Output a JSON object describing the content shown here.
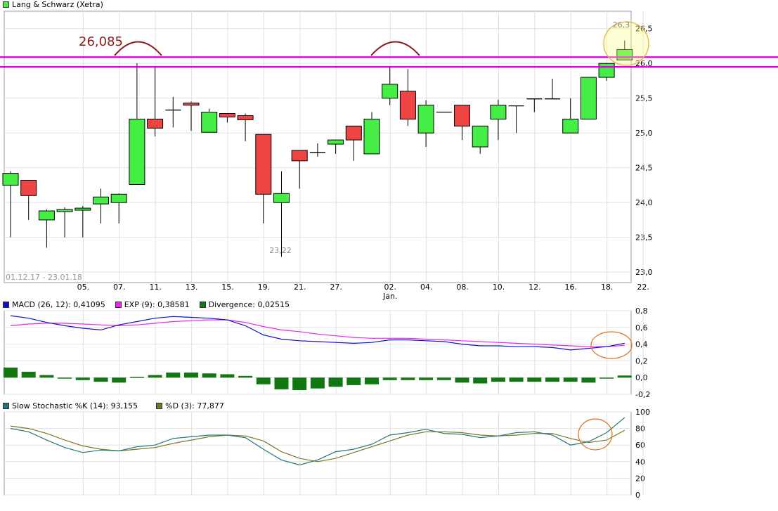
{
  "chart_data": [
    {
      "type": "candlestick",
      "title": "Lang & Schwarz (Xetra)",
      "date_range": "01.12.17 - 23.01.18",
      "x_ticks": [
        "05.",
        "07.",
        "11.",
        "13.",
        "15.",
        "19.",
        "21.",
        "27.",
        "02.",
        "04.",
        "08.",
        "10.",
        "12.",
        "16.",
        "18.",
        "22."
      ],
      "x_sublabel": "Jan.",
      "y_ticks": [
        "26,5",
        "26,0",
        "25,5",
        "25,0",
        "24,5",
        "24,0",
        "23,5",
        "23,0"
      ],
      "ylim": [
        22.85,
        26.75
      ],
      "candles": [
        {
          "o": 24.25,
          "h": 24.45,
          "l": 23.5,
          "c": 24.42
        },
        {
          "o": 24.32,
          "h": 24.32,
          "l": 23.75,
          "c": 24.1
        },
        {
          "o": 23.75,
          "h": 23.9,
          "l": 23.35,
          "c": 23.88
        },
        {
          "o": 23.87,
          "h": 23.93,
          "l": 23.5,
          "c": 23.9
        },
        {
          "o": 23.89,
          "h": 23.95,
          "l": 23.5,
          "c": 23.92
        },
        {
          "o": 23.98,
          "h": 24.2,
          "l": 23.7,
          "c": 24.08
        },
        {
          "o": 24.0,
          "h": 24.13,
          "l": 23.7,
          "c": 24.12
        },
        {
          "o": 24.26,
          "h": 26.0,
          "l": 24.26,
          "c": 25.2
        },
        {
          "o": 25.2,
          "h": 25.95,
          "l": 24.95,
          "c": 25.07
        },
        {
          "o": 25.33,
          "h": 25.52,
          "l": 25.08,
          "c": 25.33
        },
        {
          "o": 25.43,
          "h": 25.45,
          "l": 25.03,
          "c": 25.4
        },
        {
          "o": 25.01,
          "h": 25.35,
          "l": 25.01,
          "c": 25.3
        },
        {
          "o": 25.28,
          "h": 25.28,
          "l": 25.15,
          "c": 25.23
        },
        {
          "o": 25.25,
          "h": 25.28,
          "l": 24.88,
          "c": 25.19
        },
        {
          "o": 24.98,
          "h": 24.98,
          "l": 23.7,
          "c": 24.12
        },
        {
          "o": 24.0,
          "h": 24.45,
          "l": 23.22,
          "c": 24.13
        },
        {
          "o": 24.75,
          "h": 24.75,
          "l": 24.2,
          "c": 24.6
        },
        {
          "o": 24.72,
          "h": 24.85,
          "l": 24.66,
          "c": 24.72
        },
        {
          "o": 24.84,
          "h": 24.9,
          "l": 24.7,
          "c": 24.9
        },
        {
          "o": 25.1,
          "h": 25.1,
          "l": 24.6,
          "c": 24.9
        },
        {
          "o": 24.7,
          "h": 25.3,
          "l": 24.7,
          "c": 25.2
        },
        {
          "o": 25.5,
          "h": 25.95,
          "l": 25.4,
          "c": 25.7
        },
        {
          "o": 25.6,
          "h": 25.92,
          "l": 25.1,
          "c": 25.2
        },
        {
          "o": 25.0,
          "h": 25.47,
          "l": 24.8,
          "c": 25.4
        },
        {
          "o": 25.3,
          "h": 25.3,
          "l": 25.3,
          "c": 25.3
        },
        {
          "o": 25.4,
          "h": 25.4,
          "l": 24.9,
          "c": 25.1
        },
        {
          "o": 24.8,
          "h": 25.1,
          "l": 24.7,
          "c": 25.1
        },
        {
          "o": 25.2,
          "h": 25.48,
          "l": 24.9,
          "c": 25.4
        },
        {
          "o": 25.39,
          "h": 25.39,
          "l": 25.0,
          "c": 25.39
        },
        {
          "o": 25.49,
          "h": 25.49,
          "l": 25.3,
          "c": 25.49
        },
        {
          "o": 25.49,
          "h": 25.78,
          "l": 25.49,
          "c": 25.49
        },
        {
          "o": 25.0,
          "h": 25.5,
          "l": 25.0,
          "c": 25.2
        },
        {
          "o": 25.2,
          "h": 25.8,
          "l": 25.2,
          "c": 25.8
        },
        {
          "o": 25.8,
          "h": 26.0,
          "l": 25.75,
          "c": 26.0
        },
        {
          "o": 26.05,
          "h": 26.33,
          "l": 26.05,
          "c": 26.2
        }
      ],
      "up_color": "#44ee44",
      "down_color": "#ee4444",
      "annotations": {
        "resistance_label": "26,085",
        "low_label": "23,22",
        "high_label": "26,3",
        "resistance_values": [
          26.09,
          25.95
        ],
        "resistance_color": "#dd00dd"
      }
    },
    {
      "type": "line",
      "indicator": "MACD",
      "legend": [
        {
          "label": "MACD (26, 12): 0,41095",
          "color": "#1010cc"
        },
        {
          "label": "EXP (9): 0,38581",
          "color": "#ee22ee"
        },
        {
          "label": "Divergence: 0,02515",
          "color": "#117711"
        }
      ],
      "y_ticks": [
        "0,8",
        "0,6",
        "0,4",
        "0,2",
        "0,0",
        "-0,2"
      ],
      "ylim": [
        -0.2,
        0.8
      ],
      "macd": [
        0.74,
        0.71,
        0.66,
        0.62,
        0.59,
        0.57,
        0.63,
        0.67,
        0.71,
        0.73,
        0.72,
        0.71,
        0.69,
        0.62,
        0.51,
        0.46,
        0.44,
        0.43,
        0.42,
        0.41,
        0.42,
        0.45,
        0.45,
        0.44,
        0.43,
        0.4,
        0.38,
        0.38,
        0.37,
        0.37,
        0.36,
        0.33,
        0.35,
        0.37,
        0.41
      ],
      "exp": [
        0.62,
        0.64,
        0.65,
        0.65,
        0.64,
        0.63,
        0.62,
        0.63,
        0.65,
        0.67,
        0.68,
        0.69,
        0.69,
        0.66,
        0.61,
        0.57,
        0.55,
        0.52,
        0.5,
        0.48,
        0.47,
        0.47,
        0.47,
        0.46,
        0.45,
        0.44,
        0.43,
        0.42,
        0.41,
        0.4,
        0.39,
        0.38,
        0.37,
        0.37,
        0.385
      ],
      "divergence": [
        0.12,
        0.07,
        0.03,
        0.0,
        -0.03,
        -0.05,
        -0.06,
        0.01,
        0.03,
        0.06,
        0.06,
        0.05,
        0.04,
        0.02,
        -0.08,
        -0.14,
        -0.15,
        -0.13,
        -0.11,
        -0.09,
        -0.08,
        -0.03,
        -0.03,
        -0.03,
        -0.03,
        -0.06,
        -0.07,
        -0.05,
        -0.05,
        -0.05,
        -0.05,
        -0.05,
        -0.06,
        0.0,
        0.025
      ]
    },
    {
      "type": "line",
      "indicator": "Slow Stochastic",
      "legend": [
        {
          "label": "Slow Stochastic %K (14): 93,155",
          "color": "#227777"
        },
        {
          "label": "%D (3): 77,877",
          "color": "#777722"
        }
      ],
      "y_ticks": [
        "100",
        "80",
        "60",
        "40",
        "20",
        "0"
      ],
      "ylim": [
        0,
        100
      ],
      "k": [
        80,
        76,
        66,
        57,
        51,
        54,
        53,
        58,
        60,
        68,
        70,
        72,
        72,
        69,
        55,
        42,
        36,
        42,
        52,
        55,
        61,
        72,
        75,
        79,
        74,
        73,
        69,
        71,
        75,
        76,
        72,
        60,
        64,
        75,
        93.155
      ],
      "d": [
        83,
        80,
        74,
        66,
        59,
        55,
        53,
        55,
        57,
        62,
        66,
        70,
        72,
        71,
        65,
        52,
        44,
        40,
        44,
        51,
        58,
        65,
        72,
        76,
        76,
        75,
        72,
        71,
        72,
        74,
        74,
        68,
        63,
        66,
        77.877
      ]
    }
  ]
}
